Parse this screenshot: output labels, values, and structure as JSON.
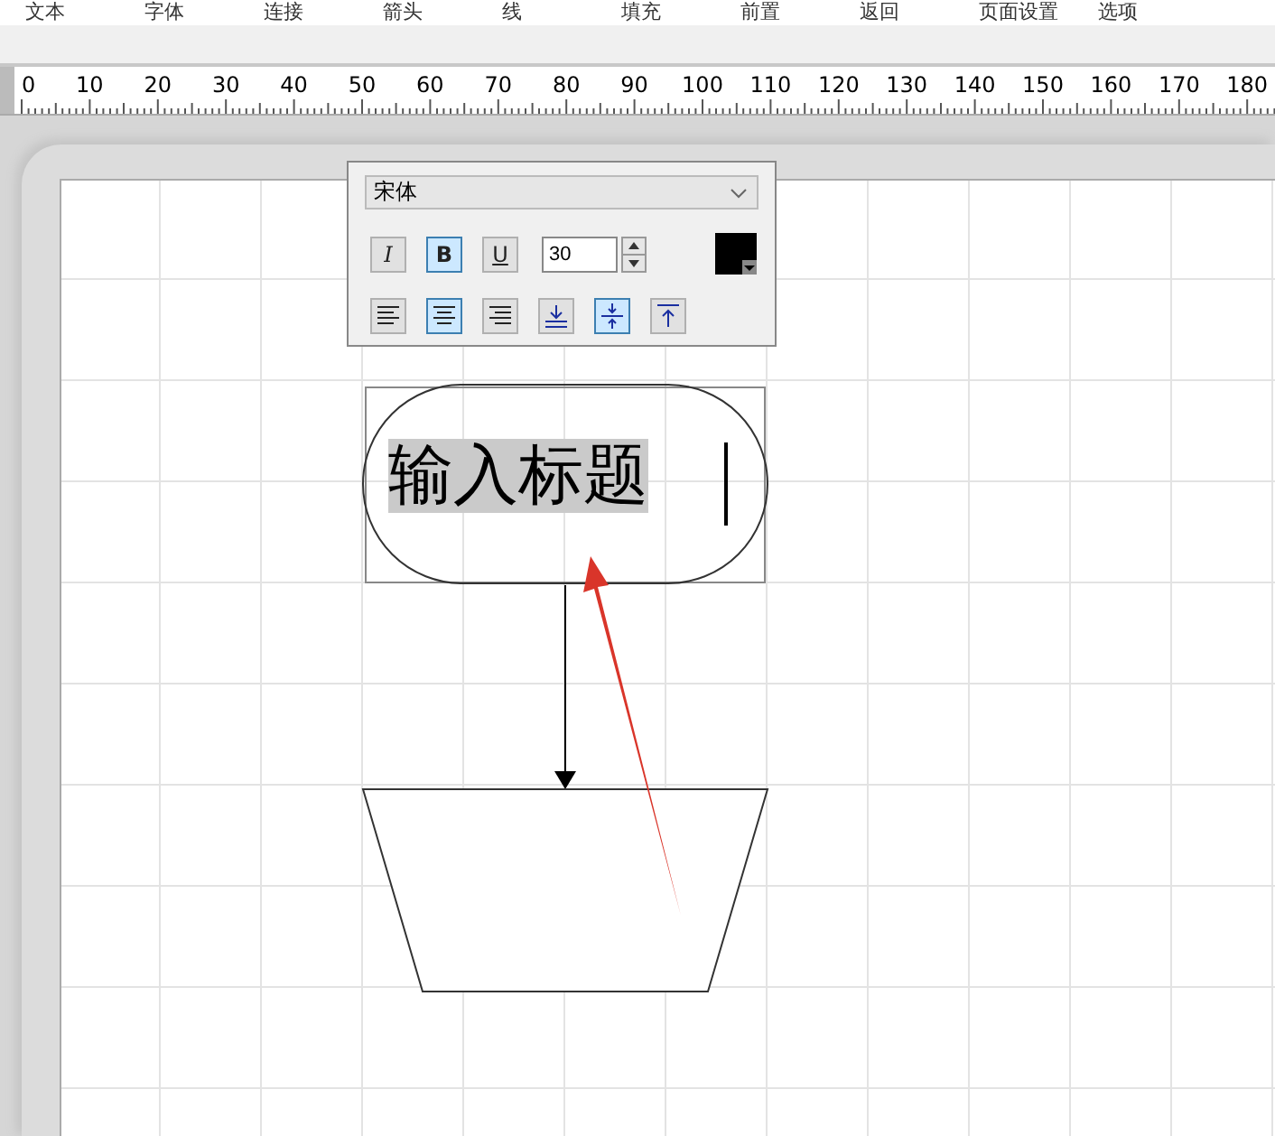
{
  "menu_tabs": [
    {
      "label": "文本"
    },
    {
      "label": "字体"
    },
    {
      "label": "连接"
    },
    {
      "label": "箭头"
    },
    {
      "label": "线"
    },
    {
      "label": "填充"
    },
    {
      "label": "前置"
    },
    {
      "label": "返回"
    },
    {
      "label": "页面设置"
    },
    {
      "label": "选项"
    }
  ],
  "ruler": {
    "labels": [
      "0",
      "10",
      "20",
      "30",
      "40",
      "50",
      "60",
      "70",
      "80",
      "90",
      "100",
      "110",
      "120",
      "130",
      "140",
      "150",
      "160",
      "170",
      "180"
    ]
  },
  "format_panel": {
    "font": "宋体",
    "size": "30",
    "style_buttons": [
      {
        "kind": "italic",
        "label": "I",
        "selected": false
      },
      {
        "kind": "bold",
        "label": "B",
        "selected": true
      },
      {
        "kind": "underline",
        "label": "U",
        "selected": false
      }
    ],
    "align_buttons": [
      {
        "kind": "align-left",
        "selected": false
      },
      {
        "kind": "align-center",
        "selected": true
      },
      {
        "kind": "align-right",
        "selected": false
      },
      {
        "kind": "valign-bottom",
        "selected": false
      },
      {
        "kind": "valign-middle",
        "selected": true
      },
      {
        "kind": "valign-top",
        "selected": false
      }
    ]
  },
  "diagram": {
    "shapes": [
      {
        "kind": "terminator",
        "text": "输入标题",
        "selected": true
      },
      {
        "kind": "connector"
      },
      {
        "kind": "trapezoid"
      },
      {
        "kind": "pointer-arrow"
      }
    ]
  }
}
